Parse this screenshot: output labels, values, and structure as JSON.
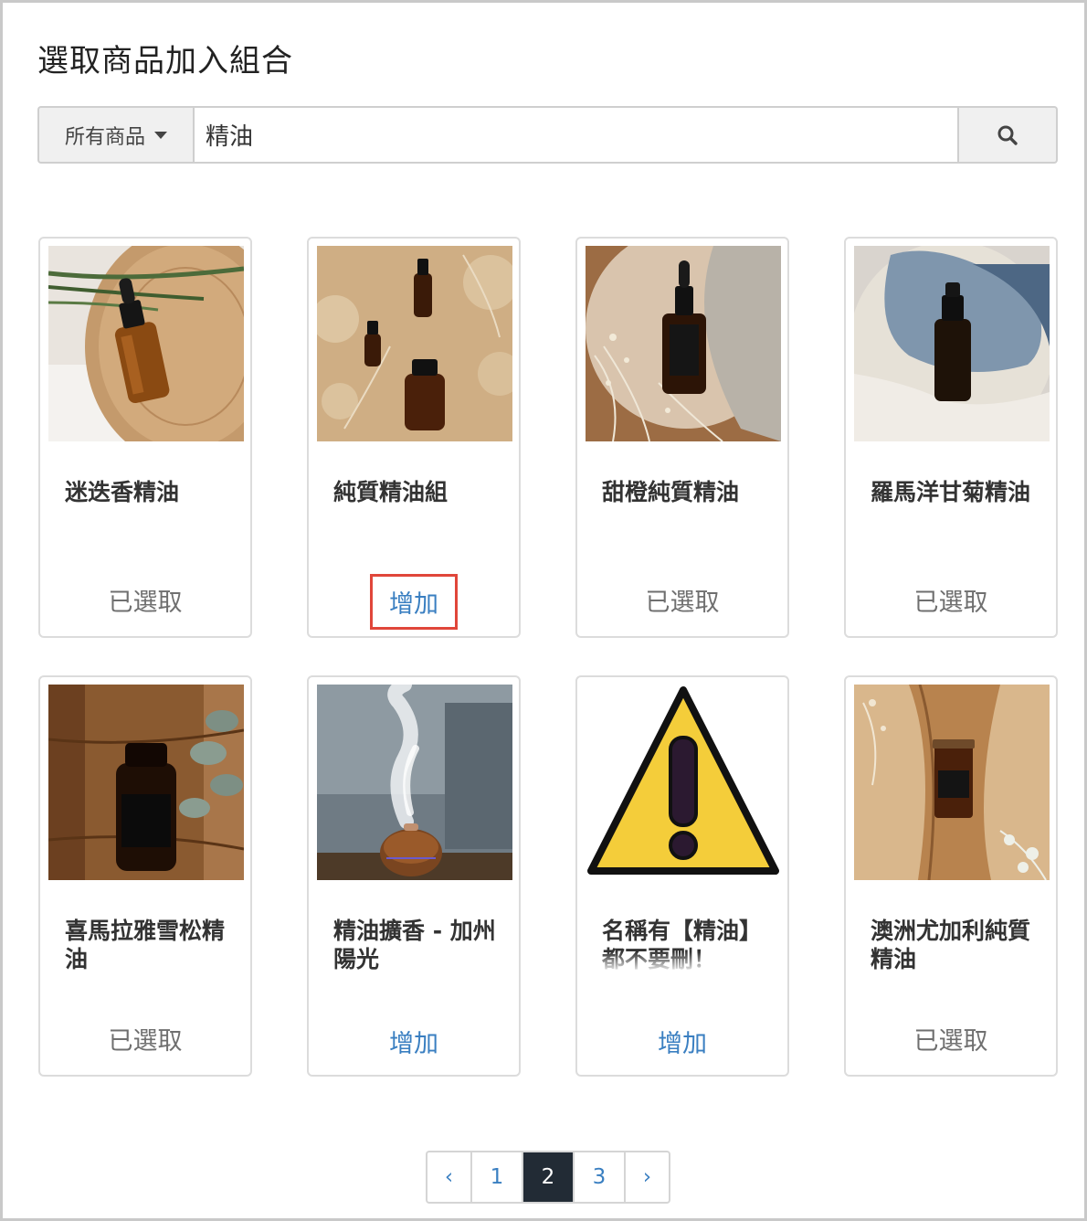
{
  "dialog": {
    "title": "選取商品加入組合"
  },
  "search": {
    "filter_label": "所有商品",
    "query": "精油",
    "search_icon": "search-icon"
  },
  "products": [
    {
      "name": "迷迭香精油",
      "status": "已選取",
      "action": "selected"
    },
    {
      "name": "純質精油組",
      "status": "增加",
      "action": "add",
      "highlighted": true
    },
    {
      "name": "甜橙純質精油",
      "status": "已選取",
      "action": "selected"
    },
    {
      "name": "羅馬洋甘菊精油",
      "status": "已選取",
      "action": "selected"
    },
    {
      "name": "喜馬拉雅雪松精油",
      "status": "已選取",
      "action": "selected"
    },
    {
      "name": "精油擴香 - 加州陽光",
      "status": "增加",
      "action": "add"
    },
    {
      "name": "名稱有【精油】都不要刪！",
      "status": "增加",
      "action": "add"
    },
    {
      "name": "澳洲尤加利純質精油",
      "status": "已選取",
      "action": "selected"
    }
  ],
  "pagination": {
    "prev": "‹",
    "pages": [
      "1",
      "2",
      "3"
    ],
    "current": "2",
    "next": "›"
  },
  "colors": {
    "link": "#3a7fc1",
    "selected_text": "#6f6f6f",
    "highlight_border": "#e0463a",
    "active_page": "#222b35"
  }
}
